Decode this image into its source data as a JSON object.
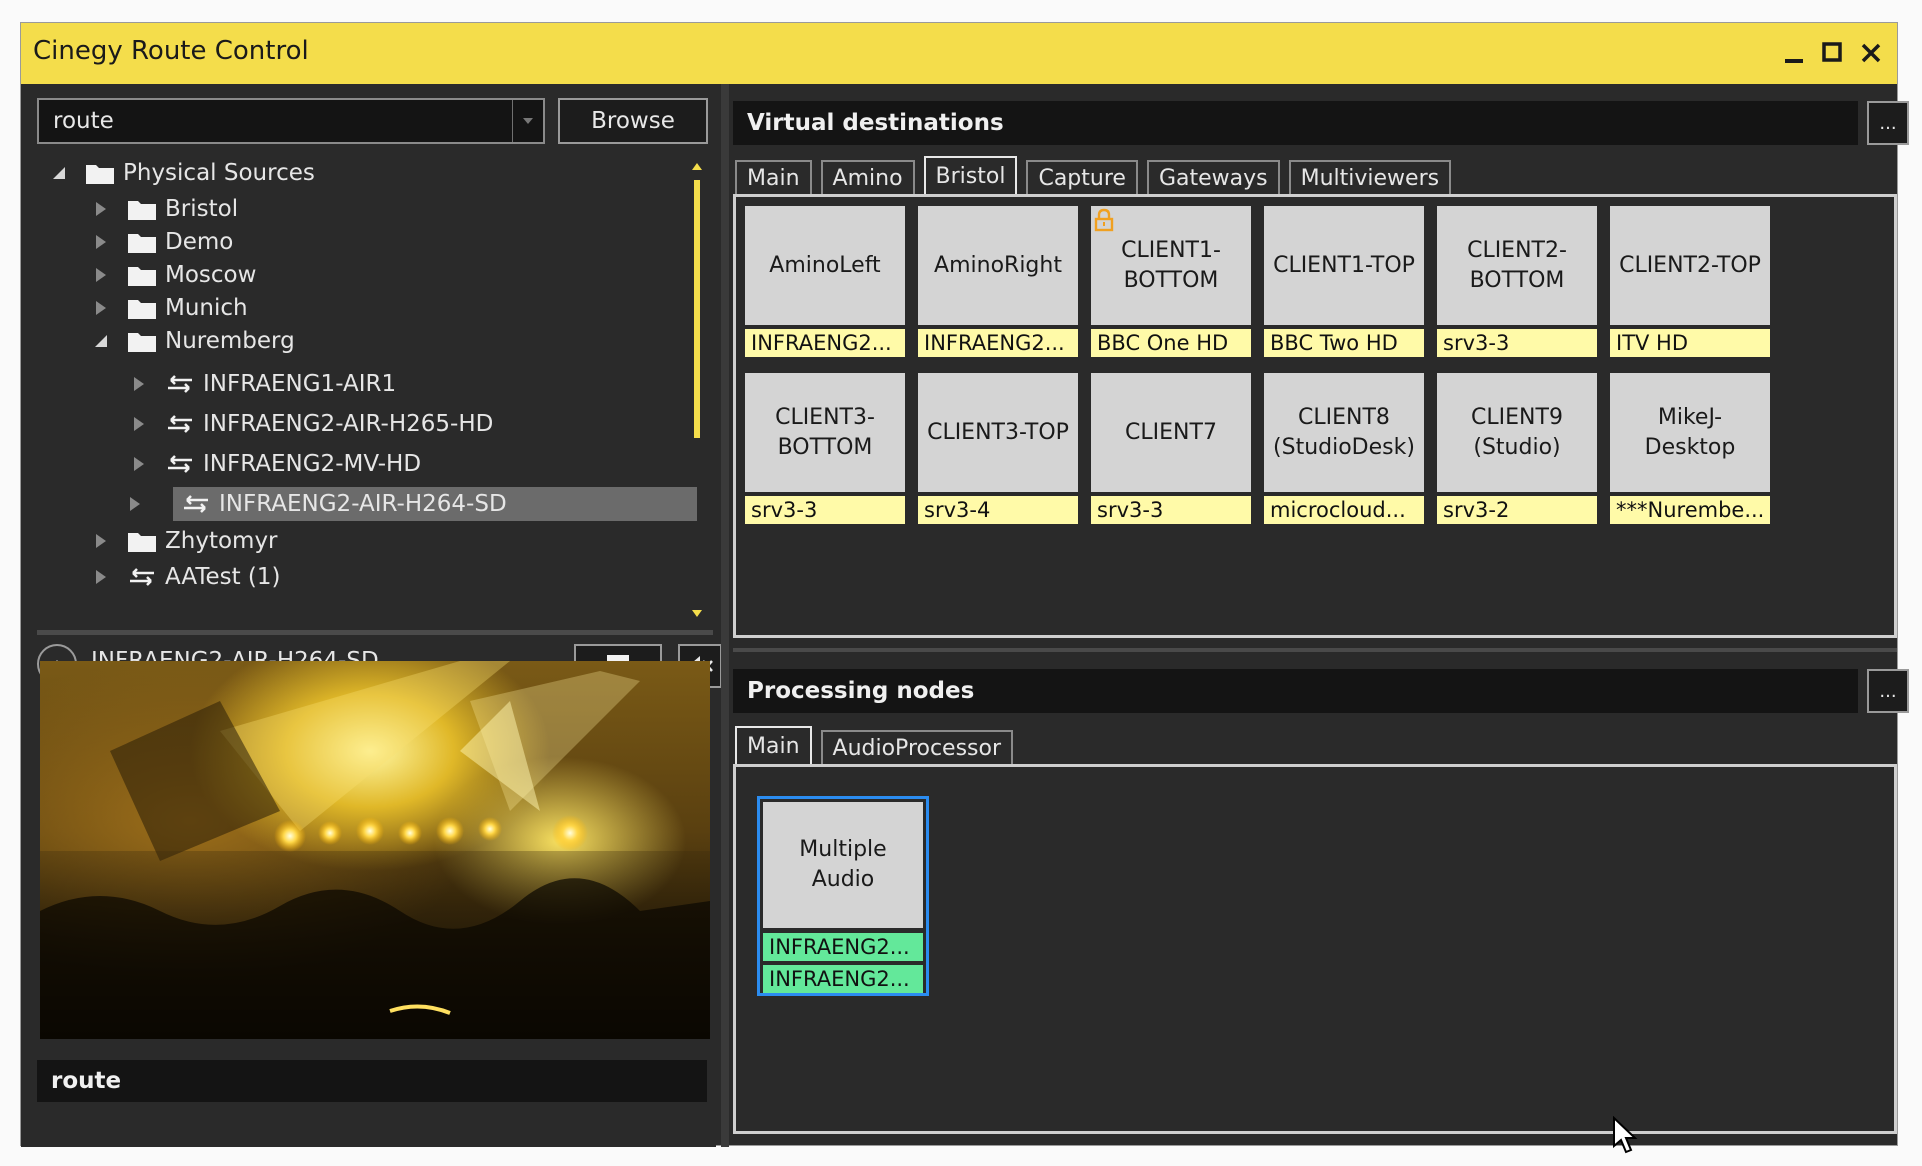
{
  "window": {
    "title": "Cinegy Route Control"
  },
  "search": {
    "value": "route",
    "browse_label": "Browse"
  },
  "tree": {
    "root": "Physical Sources",
    "folders": [
      "Bristol",
      "Demo",
      "Moscow",
      "Munich",
      "Nuremberg"
    ],
    "nuremberg_items": [
      "INFRAENG1-AIR1",
      "INFRAENG2-AIR-H265-HD",
      "INFRAENG2-MV-HD",
      "INFRAENG2-AIR-H264-SD"
    ],
    "after": [
      "Zhytomyr",
      "AATest (1)"
    ],
    "selected": "INFRAENG2-AIR-H264-SD"
  },
  "preview": {
    "title": "INFRAENG2-AIR-H264-SD"
  },
  "status": {
    "text": "route"
  },
  "virtual_destinations": {
    "title": "Virtual destinations",
    "more_label": "...",
    "tabs": [
      "Main",
      "Amino",
      "Bristol",
      "Capture",
      "Gateways",
      "Multiviewers"
    ],
    "active_tab": "Bristol",
    "tiles": [
      {
        "name": "AminoLeft",
        "source": "INFRAENG2..."
      },
      {
        "name": "AminoRight",
        "source": "INFRAENG2..."
      },
      {
        "name": "CLIENT1-\nBOTTOM",
        "source": "BBC One HD",
        "locked": true
      },
      {
        "name": "CLIENT1-TOP",
        "source": "BBC Two HD"
      },
      {
        "name": "CLIENT2-\nBOTTOM",
        "source": "srv3-3"
      },
      {
        "name": "CLIENT2-TOP",
        "source": "ITV HD"
      },
      {
        "name": "CLIENT3-\nBOTTOM",
        "source": "srv3-3"
      },
      {
        "name": "CLIENT3-TOP",
        "source": "srv3-4"
      },
      {
        "name": "CLIENT7",
        "source": "srv3-3"
      },
      {
        "name": "CLIENT8\n(StudioDesk)",
        "source": "microcloud..."
      },
      {
        "name": "CLIENT9\n(Studio)",
        "source": "srv3-2"
      },
      {
        "name": "MikeJ-\nDesktop",
        "source": "***Nurembe..."
      }
    ]
  },
  "processing_nodes": {
    "title": "Processing nodes",
    "more_label": "...",
    "tabs": [
      "Main",
      "AudioProcessor"
    ],
    "active_tab": "Main",
    "node": {
      "name": "Multiple\nAudio",
      "inputs": [
        "INFRAENG2...",
        "INFRAENG2..."
      ]
    }
  },
  "colors": {
    "titlebar": "#f4dd4b",
    "source_label": "#fffaa8",
    "node_input": "#63e89a",
    "node_border": "#2b8cf0",
    "tile_face": "#d4d4d4"
  },
  "icons": [
    "minimize-icon",
    "maximize-icon",
    "close-icon",
    "folder-icon",
    "route-icon",
    "lock-icon",
    "mute-icon",
    "stop-icon",
    "eject-icon",
    "cursor-icon"
  ]
}
